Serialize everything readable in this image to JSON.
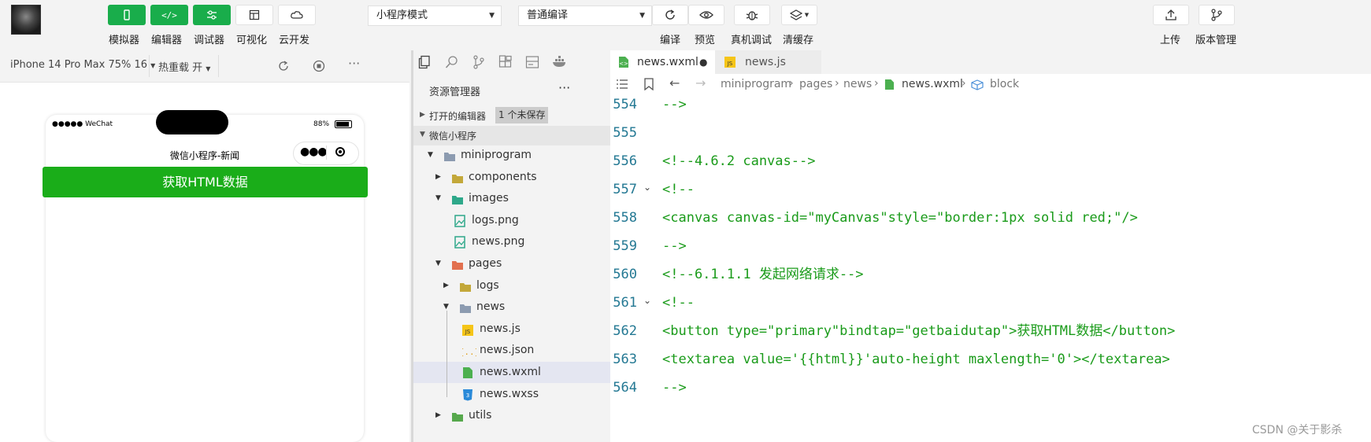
{
  "toolbar": {
    "buttons": [
      {
        "label": "模拟器",
        "icon": "phone-icon"
      },
      {
        "label": "编辑器",
        "icon": "code-icon"
      },
      {
        "label": "调试器",
        "icon": "debug-toggle-icon"
      },
      {
        "label": "可视化",
        "icon": "layout-icon"
      },
      {
        "label": "云开发",
        "icon": "cloud-icon"
      }
    ],
    "mode_select": "小程序模式",
    "compile_select": "普通编译",
    "actions": [
      {
        "label": "编译",
        "icon": "refresh-icon"
      },
      {
        "label": "预览",
        "icon": "eye-icon"
      },
      {
        "label": "真机调试",
        "icon": "bug-icon"
      },
      {
        "label": "清缓存",
        "icon": "layers-icon"
      }
    ],
    "upload": "上传",
    "version": "版本管理"
  },
  "simbar": {
    "device": "iPhone 14 Pro Max 75% 16",
    "hot_reload": "热重载 开"
  },
  "phone": {
    "carrier": "●●●●● WeChat",
    "battery": "88%",
    "title": "微信小程序-新闻",
    "primary_button": "获取HTML数据"
  },
  "explorer": {
    "title": "资源管理器",
    "more": "···",
    "open_editors": "打开的编辑器",
    "unsaved": "1 个未保存",
    "project": "微信小程序",
    "tree": [
      {
        "label": "miniprogram",
        "depth": 0,
        "type": "folder-open"
      },
      {
        "label": "components",
        "depth": 1,
        "type": "folder-closed"
      },
      {
        "label": "images",
        "depth": 1,
        "type": "folder-open"
      },
      {
        "label": "logs.png",
        "depth": 2,
        "type": "image"
      },
      {
        "label": "news.png",
        "depth": 2,
        "type": "image"
      },
      {
        "label": "pages",
        "depth": 1,
        "type": "folder-open"
      },
      {
        "label": "logs",
        "depth": 2,
        "type": "folder-closed"
      },
      {
        "label": "news",
        "depth": 2,
        "type": "folder-open"
      },
      {
        "label": "news.js",
        "depth": 3,
        "type": "js"
      },
      {
        "label": "news.json",
        "depth": 3,
        "type": "json"
      },
      {
        "label": "news.wxml",
        "depth": 3,
        "type": "wxml"
      },
      {
        "label": "news.wxss",
        "depth": 3,
        "type": "wxss"
      },
      {
        "label": "utils",
        "depth": 1,
        "type": "folder-closed"
      }
    ]
  },
  "editor": {
    "tabs": [
      {
        "label": "news.wxml",
        "modified": "●"
      },
      {
        "label": "news.js",
        "modified": ""
      }
    ],
    "breadcrumb": [
      "miniprogram",
      "pages",
      "news",
      "news.wxml",
      "block"
    ],
    "lines": [
      {
        "num": "554",
        "text": "-->"
      },
      {
        "num": "555",
        "text": ""
      },
      {
        "num": "556",
        "text": "<!--4.6.2 canvas-->"
      },
      {
        "num": "557",
        "text": "<!--"
      },
      {
        "num": "558",
        "text": "<canvas canvas-id=\"myCanvas\"style=\"border:1px solid red;\"/>"
      },
      {
        "num": "559",
        "text": "-->"
      },
      {
        "num": "560",
        "text": "<!--6.1.1.1 发起网络请求-->"
      },
      {
        "num": "561",
        "text": "<!--"
      },
      {
        "num": "562",
        "text": "<button type=\"primary\"bindtap=\"getbaidutap\">获取HTML数据</button>"
      },
      {
        "num": "563",
        "text": "<textarea value='{{html}}'auto-height maxlength='0'></textarea>"
      },
      {
        "num": "564",
        "text": "-->"
      }
    ]
  },
  "watermark": "CSDN @关于影杀",
  "colors": {
    "accent_green": "#19ad4b",
    "code_green": "#1a9b1a",
    "line_number": "#237893"
  }
}
